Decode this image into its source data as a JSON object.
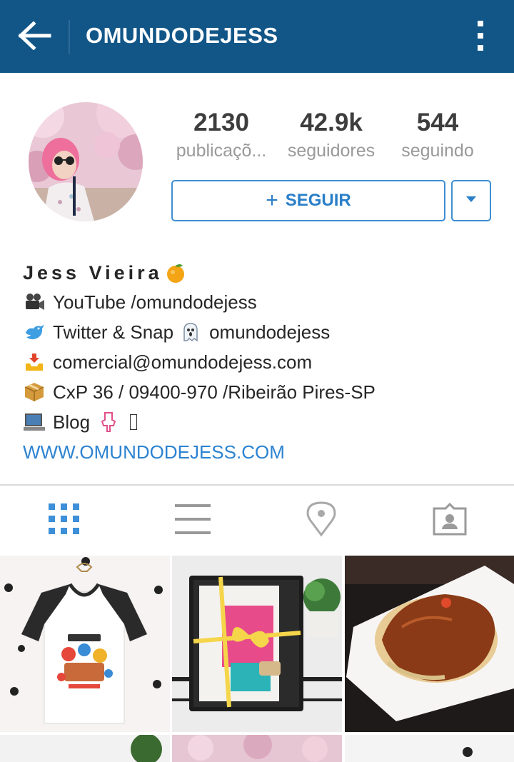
{
  "header": {
    "title": "OMUNDODEJESS",
    "back_icon": "arrow-left-icon",
    "menu_icon": "more-vertical-icon",
    "background": "#125688"
  },
  "profile": {
    "avatar_icon": "profile-photo",
    "stats": [
      {
        "value": "2130",
        "label": "publicaçõ..."
      },
      {
        "value": "42.9k",
        "label": "seguidores"
      },
      {
        "value": "544",
        "label": "seguindo"
      }
    ],
    "follow_label": "SEGUIR",
    "follow_plus": "+",
    "accent": "#3f8fd2"
  },
  "bio": {
    "name": "Jess Vieira",
    "lines": [
      {
        "icon": "movie-camera-icon",
        "text": "YouTube /omundodejess"
      },
      {
        "icon": "bird-icon",
        "text": "Twitter & Snap",
        "icon2": "ghost-icon",
        "text2": "omundodejess"
      },
      {
        "icon": "inbox-download-icon",
        "text": "comercial@omundodejess.com"
      },
      {
        "icon": "package-icon",
        "text": "CxP 36 / 09400-970 /Ribeirão Pires-SP"
      },
      {
        "icon": "computer-icon",
        "text": "Blog"
      }
    ],
    "link": "WWW.OMUNDODEJESS.COM",
    "link_color": "#2d83d0"
  },
  "tabs": [
    {
      "name": "grid-view",
      "icon": "grid-icon",
      "active": true
    },
    {
      "name": "list-view",
      "icon": "list-icon",
      "active": false
    },
    {
      "name": "places",
      "icon": "location-pin-icon",
      "active": false
    },
    {
      "name": "tagged",
      "icon": "tagged-person-icon",
      "active": false
    }
  ],
  "grid": {
    "tiles": [
      "t-shirt-photo",
      "notebook-gift-photo",
      "waffle-chocolate-photo",
      "plant-photo",
      "cherry-blossom-photo",
      "polka-dot-photo"
    ]
  }
}
